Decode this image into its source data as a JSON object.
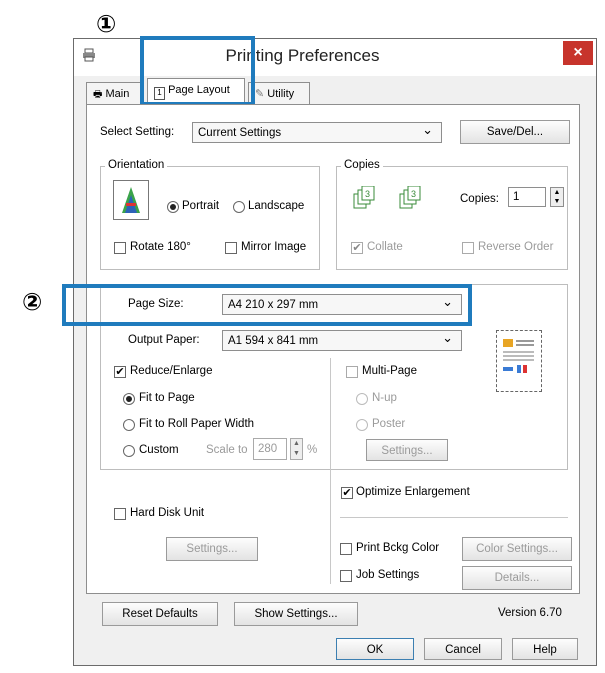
{
  "callouts": {
    "one": "①",
    "two": "②"
  },
  "window": {
    "title": "Printing Preferences",
    "close": "×"
  },
  "tabs": [
    {
      "label": "Main"
    },
    {
      "label": "Page Layout"
    },
    {
      "label": "Utility"
    }
  ],
  "select_setting": {
    "label": "Select Setting:",
    "value": "Current Settings",
    "save_button": "Save/Del..."
  },
  "orientation": {
    "legend": "Orientation",
    "portrait": "Portrait",
    "landscape": "Landscape",
    "rotate": "Rotate 180°",
    "mirror": "Mirror Image",
    "selected": "Portrait"
  },
  "copies": {
    "legend": "Copies",
    "label": "Copies:",
    "value": "1",
    "collate": "Collate",
    "reverse": "Reverse Order"
  },
  "page_size": {
    "label": "Page Size:",
    "value": "A4 210 x 297 mm"
  },
  "output_paper": {
    "label": "Output Paper:",
    "value": "A1 594 x 841 mm"
  },
  "reduce": {
    "label": "Reduce/Enlarge",
    "fit_page": "Fit to Page",
    "fit_roll": "Fit to Roll Paper Width",
    "custom": "Custom",
    "scale_label": "Scale to",
    "scale_value": "280",
    "percent": "%"
  },
  "multipage": {
    "label": "Multi-Page",
    "nup": "N-up",
    "poster": "Poster",
    "settings": "Settings..."
  },
  "optimize": {
    "label": "Optimize Enlargement"
  },
  "hard_disk": {
    "label": "Hard Disk Unit",
    "settings": "Settings..."
  },
  "print_bckg": {
    "label": "Print Bckg Color",
    "button": "Color Settings..."
  },
  "job": {
    "label": "Job Settings",
    "button": "Details..."
  },
  "bottom": {
    "reset": "Reset Defaults",
    "show": "Show Settings...",
    "version": "Version 6.70"
  },
  "footer": {
    "ok": "OK",
    "cancel": "Cancel",
    "help": "Help"
  }
}
